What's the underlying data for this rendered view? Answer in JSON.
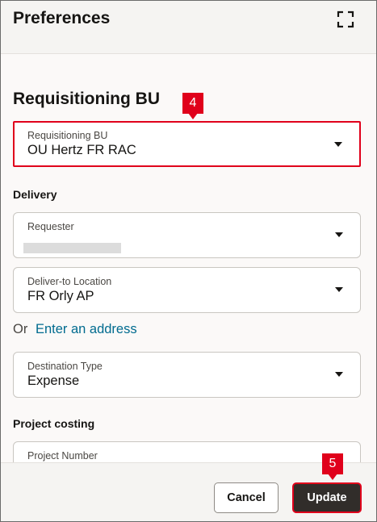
{
  "dialog": {
    "title": "Preferences",
    "expand_icon": "expand-icon"
  },
  "requisitioning": {
    "section_title": "Requisitioning BU",
    "field": {
      "label": "Requisitioning BU",
      "value": "OU Hertz FR RAC"
    }
  },
  "delivery": {
    "section_title": "Delivery",
    "requester": {
      "label": "Requester",
      "value": ""
    },
    "deliver_to": {
      "label": "Deliver-to Location",
      "value": "FR Orly AP"
    },
    "or_text": "Or",
    "address_link": "Enter an address",
    "destination_type": {
      "label": "Destination Type",
      "value": "Expense"
    }
  },
  "project_costing": {
    "section_title": "Project costing",
    "project_number": {
      "label": "Project Number"
    }
  },
  "footer": {
    "cancel_label": "Cancel",
    "update_label": "Update"
  },
  "callouts": {
    "step_4": "4",
    "step_5": "5"
  },
  "colors": {
    "highlight": "#e0001b",
    "link": "#006b8f",
    "primary_button": "#312d2a"
  }
}
